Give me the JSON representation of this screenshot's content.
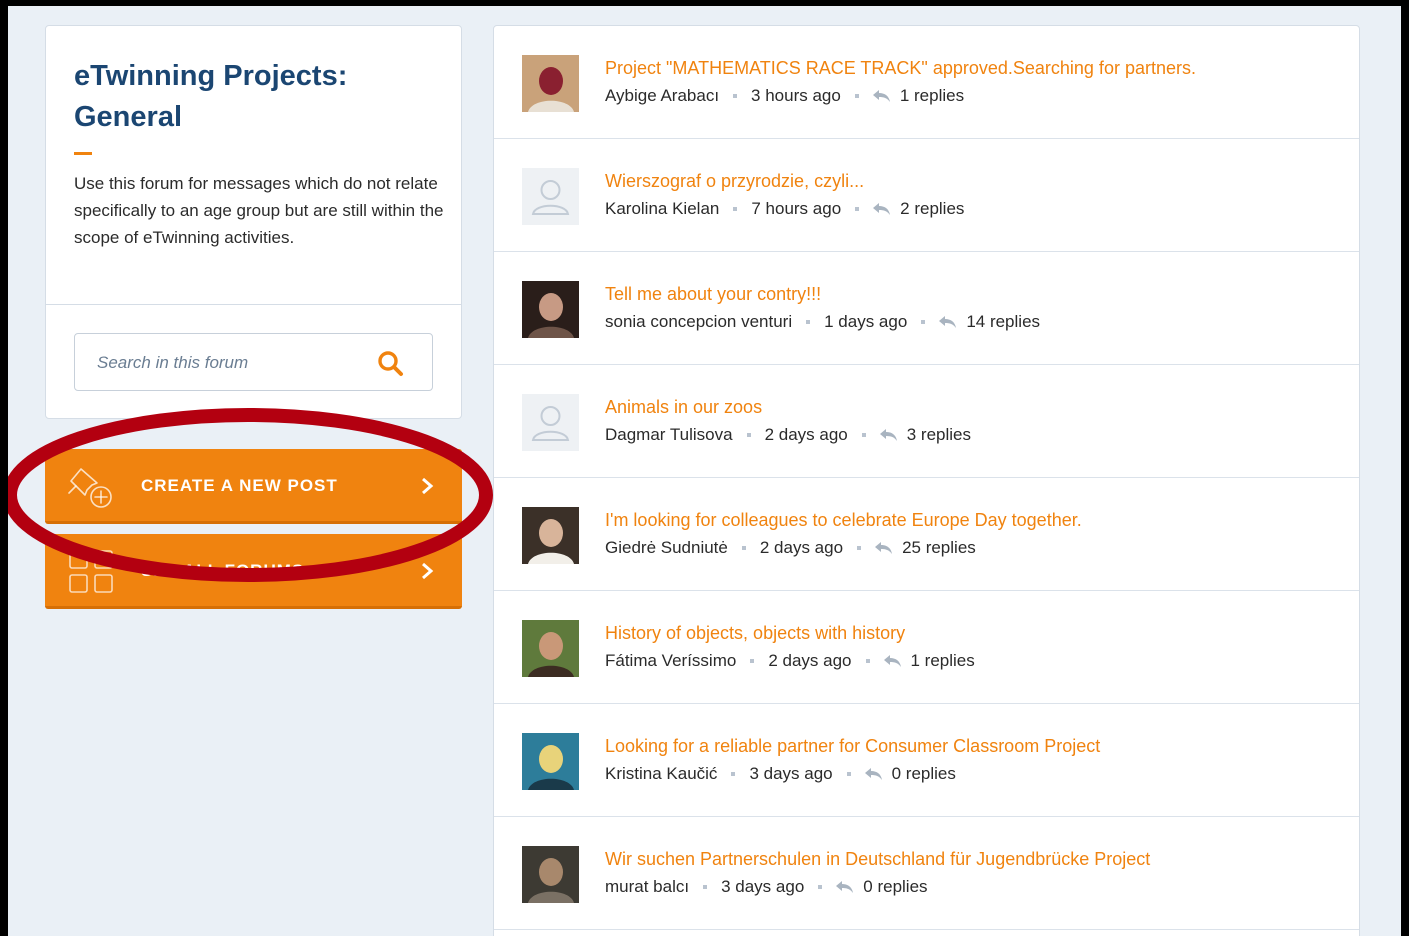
{
  "sidebar": {
    "title": "eTwinning Projects: General",
    "description": "Use this forum for messages which do not relate specifically to an age group but are still within the scope of eTwinning activities.",
    "search_placeholder": "Search in this forum",
    "create_button_label": "CREATE A NEW POST",
    "forums_button_label": "SEE ALL FORUMS"
  },
  "icons": {
    "search": "search-icon",
    "create": "pin-plus-icon",
    "forums": "grid-icon",
    "chevron": "chevron-right-icon",
    "reply": "reply-icon",
    "avatar_placeholder": "user-silhouette-icon"
  },
  "colors": {
    "accent": "#f0830f",
    "title": "#1b4672",
    "background": "#eaf0f6",
    "annotation": "#b30010"
  },
  "posts": [
    {
      "title": "Project \"MATHEMATICS RACE TRACK\" approved.Searching for partners.",
      "author": "Aybige Arabacı",
      "time": "3 hours ago",
      "replies": "1 replies",
      "avatar": "photo",
      "avatar_colors": [
        "#c9a27a",
        "#8a2030",
        "#e8e0d4"
      ]
    },
    {
      "title": "Wierszograf o przyrodzie, czyli...",
      "author": "Karolina Kielan",
      "time": "7 hours ago",
      "replies": "2 replies",
      "avatar": "placeholder",
      "avatar_colors": [
        "#eef1f4",
        "#c3ccd6",
        "#c3ccd6"
      ]
    },
    {
      "title": "Tell me about your contry!!!",
      "author": "sonia concepcion venturi",
      "time": "1 days ago",
      "replies": "14 replies",
      "avatar": "photo",
      "avatar_colors": [
        "#2a1e1a",
        "#c79a84",
        "#6e5448"
      ]
    },
    {
      "title": "Animals in our zoos",
      "author": "Dagmar Tulisova",
      "time": "2 days ago",
      "replies": "3 replies",
      "avatar": "placeholder",
      "avatar_colors": [
        "#eef1f4",
        "#c3ccd6",
        "#c3ccd6"
      ]
    },
    {
      "title": "I'm looking for colleagues to celebrate Europe Day together.",
      "author": "Giedrė Sudniutė",
      "time": "2 days ago",
      "replies": "25 replies",
      "avatar": "photo",
      "avatar_colors": [
        "#3b3028",
        "#d8b49a",
        "#f2efe9"
      ]
    },
    {
      "title": "History of objects, objects with history",
      "author": "Fátima Veríssimo",
      "time": "2 days ago",
      "replies": "1 replies",
      "avatar": "photo",
      "avatar_colors": [
        "#5f7a3c",
        "#c99878",
        "#3c2c22"
      ]
    },
    {
      "title": "Looking for a reliable partner for Consumer Classroom Project",
      "author": "Kristina Kaučić",
      "time": "3 days ago",
      "replies": "0 replies",
      "avatar": "photo",
      "avatar_colors": [
        "#2d7d9a",
        "#e8d37a",
        "#1a3a4a"
      ]
    },
    {
      "title": "Wir suchen Partnerschulen in Deutschland für Jugendbrücke Project",
      "author": "murat balcı",
      "time": "3 days ago",
      "replies": "0 replies",
      "avatar": "photo",
      "avatar_colors": [
        "#3d3a33",
        "#a8886c",
        "#7a7064"
      ]
    }
  ]
}
